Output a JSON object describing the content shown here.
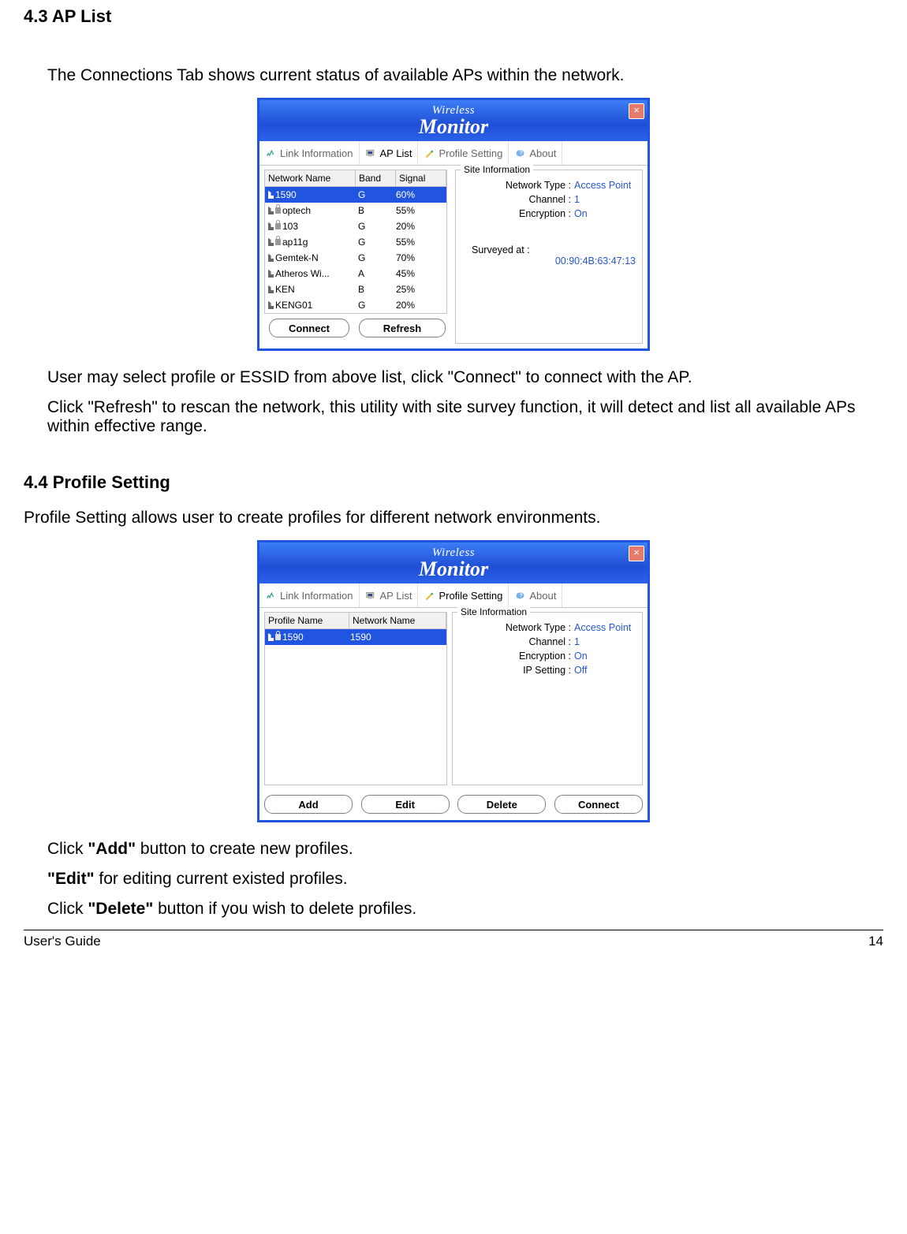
{
  "doc": {
    "h43": "4.3 AP List",
    "p_connections": "The Connections Tab shows current status of available APs within the network.",
    "p_select": "User may select profile or ESSID from above list, click \"Connect\" to connect with the AP.",
    "p_refresh": "Click \"Refresh\" to rescan the network, this utility with site survey function, it will detect and list all available APs within effective range.",
    "h44": "4.4 Profile Setting",
    "p_profile": "Profile Setting allows user to create profiles for different network environments.",
    "p_add_pre": "Click ",
    "p_add_bold": "\"Add\"",
    "p_add_post": " button to create new profiles.",
    "p_edit_bold": "\"Edit\"",
    "p_edit_post": " for editing current existed profiles.",
    "p_delete_pre": "Click ",
    "p_delete_bold": "\"Delete\"",
    "p_delete_post": " button if you wish to delete profiles.",
    "footer_left": "User's Guide",
    "footer_right": "14"
  },
  "app": {
    "title_wireless": "Wireless",
    "title_monitor": "Monitor",
    "close": "×",
    "tabs": {
      "link_info": "Link Information",
      "ap_list": "AP List",
      "profile_setting": "Profile Setting",
      "about": "About"
    },
    "site_info_legend": "Site Information",
    "labels": {
      "network_type": "Network Type :",
      "channel": "Channel :",
      "encryption": "Encryption :",
      "ip_setting": "IP Setting :",
      "surveyed": "Surveyed at :"
    }
  },
  "aplist": {
    "columns": {
      "name": "Network Name",
      "band": "Band",
      "signal": "Signal"
    },
    "rows": [
      {
        "name": "1590",
        "band": "G",
        "signal": "60%",
        "locked": false,
        "selected": true
      },
      {
        "name": "optech",
        "band": "B",
        "signal": "55%",
        "locked": true,
        "selected": false
      },
      {
        "name": "103",
        "band": "G",
        "signal": "20%",
        "locked": true,
        "selected": false
      },
      {
        "name": "ap11g",
        "band": "G",
        "signal": "55%",
        "locked": true,
        "selected": false
      },
      {
        "name": "Gemtek-N",
        "band": "G",
        "signal": "70%",
        "locked": false,
        "selected": false
      },
      {
        "name": "Atheros Wi...",
        "band": "A",
        "signal": "45%",
        "locked": false,
        "selected": false
      },
      {
        "name": "KEN",
        "band": "B",
        "signal": "25%",
        "locked": false,
        "selected": false
      },
      {
        "name": "KENG01",
        "band": "G",
        "signal": "20%",
        "locked": false,
        "selected": false
      }
    ],
    "site": {
      "network_type": "Access Point",
      "channel": "1",
      "encryption": "On",
      "mac": "00:90:4B:63:47:13"
    },
    "buttons": {
      "connect": "Connect",
      "refresh": "Refresh"
    }
  },
  "profile": {
    "columns": {
      "pname": "Profile Name",
      "nname": "Network Name"
    },
    "rows": [
      {
        "pname": "1590",
        "nname": "1590",
        "locked": true,
        "selected": true
      }
    ],
    "site": {
      "network_type": "Access Point",
      "channel": "1",
      "encryption": "On",
      "ip_setting": "Off"
    },
    "buttons": {
      "add": "Add",
      "edit": "Edit",
      "delete": "Delete",
      "connect": "Connect"
    }
  }
}
